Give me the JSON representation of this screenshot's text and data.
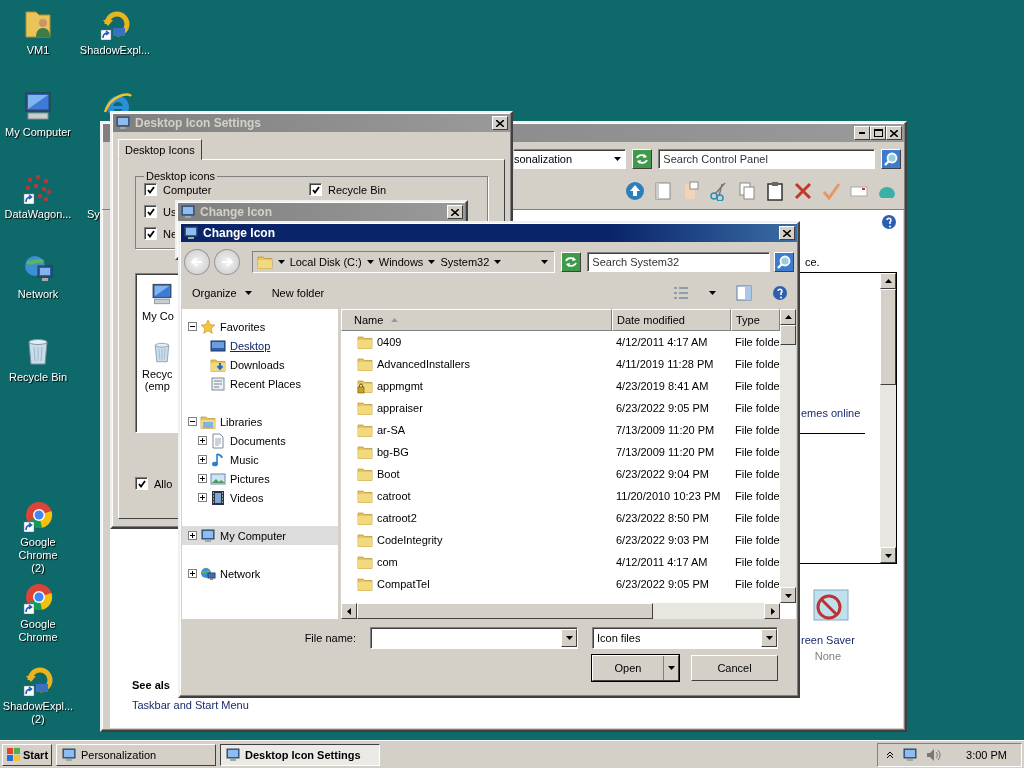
{
  "desktop_icons": [
    {
      "label": "VM1",
      "kind": "user-folder"
    },
    {
      "label": "ShadowExpl...",
      "kind": "shadow"
    },
    {
      "label": "My Computer",
      "kind": "computer"
    },
    {
      "kind": "browser-e"
    },
    {
      "label": "DataWagon...",
      "kind": "dots"
    },
    {
      "label": "Sy",
      "kind": "label-only"
    },
    {
      "label": "Network",
      "kind": "network"
    },
    {
      "label": "Recycle Bin",
      "kind": "recycle"
    },
    {
      "label": "Google Chrome\n(2)",
      "kind": "chrome"
    },
    {
      "label": "Google Chrome",
      "kind": "chrome"
    },
    {
      "label": "ShadowExpl...\n(2)",
      "kind": "shadow"
    }
  ],
  "personalization_window": {
    "active": false,
    "address": "sonalization",
    "search": {
      "placeholder": "Search Control Panel"
    },
    "text_fragment": "ce.",
    "theme_link": "emes online",
    "screen_saver": {
      "label": "reen Saver",
      "value": "None"
    },
    "see_also": {
      "heading": "See als",
      "links": [
        "Taskbar and Start Menu"
      ]
    }
  },
  "desktop_icon_settings": {
    "title": "Desktop Icon Settings",
    "active": false,
    "tabs": [
      {
        "label": "Desktop Icons",
        "selected": true
      }
    ],
    "group_label": "Desktop icons",
    "checkboxes": [
      {
        "label": "Computer",
        "checked": true
      },
      {
        "label": "Recycle Bin",
        "checked": true
      },
      {
        "label": "Us",
        "checked": true
      },
      {
        "label": "Ne",
        "checked": true
      }
    ],
    "icon_list": [
      {
        "label": "My Co",
        "kind": "computer"
      },
      {
        "label": "Recyc\n(emp",
        "kind": "recycle"
      }
    ],
    "allow": {
      "label": "Allo",
      "checked": true
    }
  },
  "background_dialog": {
    "title": "Change Icon",
    "active": false
  },
  "change_icon": {
    "title": "Change Icon",
    "active": true,
    "breadcrumbs": [
      "Local Disk (C:)",
      "Windows",
      "System32"
    ],
    "search": {
      "placeholder": "Search System32"
    },
    "commands": [
      {
        "label": "Organize",
        "menu": true
      },
      {
        "label": "New folder",
        "menu": false
      }
    ],
    "nav": [
      {
        "label": "Favorites",
        "kind": "star",
        "expanded": true,
        "selected": false,
        "hovered": false,
        "children": [
          {
            "label": "Desktop",
            "kind": "desktop",
            "selected": false,
            "hovered": true
          },
          {
            "label": "Downloads",
            "kind": "downloads",
            "selected": false,
            "hovered": false
          },
          {
            "label": "Recent Places",
            "kind": "recent",
            "selected": false,
            "hovered": false
          }
        ]
      },
      {
        "label": "Libraries",
        "kind": "library",
        "expanded": true,
        "selected": false,
        "hovered": false,
        "children": [
          {
            "label": "Documents",
            "kind": "documents",
            "expanded": false,
            "selected": false,
            "hovered": false
          },
          {
            "label": "Music",
            "kind": "music",
            "expanded": false,
            "selected": false,
            "hovered": false
          },
          {
            "label": "Pictures",
            "kind": "pictures",
            "expanded": false,
            "selected": false,
            "hovered": false
          },
          {
            "label": "Videos",
            "kind": "videos",
            "expanded": false,
            "selected": false,
            "hovered": false
          }
        ]
      },
      {
        "label": "My Computer",
        "kind": "computer",
        "expanded": false,
        "selected": true,
        "hovered": false
      },
      {
        "label": "Network",
        "kind": "network",
        "expanded": false,
        "selected": false,
        "hovered": false
      }
    ],
    "columns": [
      {
        "label": "Name",
        "sorted": true
      },
      {
        "label": "Date modified",
        "sorted": false
      },
      {
        "label": "Type",
        "sorted": false
      }
    ],
    "rows": [
      {
        "name": "0409",
        "date": "4/12/2011 4:17 AM",
        "type": "File folde",
        "kind": "folder"
      },
      {
        "name": "AdvancedInstallers",
        "date": "4/11/2019 11:28 PM",
        "type": "File folde",
        "kind": "folder"
      },
      {
        "name": "appmgmt",
        "date": "4/23/2019 8:41 AM",
        "type": "File folde",
        "kind": "locked-folder"
      },
      {
        "name": "appraiser",
        "date": "6/23/2022 9:05 PM",
        "type": "File folde",
        "kind": "folder"
      },
      {
        "name": "ar-SA",
        "date": "7/13/2009 11:20 PM",
        "type": "File folde",
        "kind": "folder"
      },
      {
        "name": "bg-BG",
        "date": "7/13/2009 11:20 PM",
        "type": "File folde",
        "kind": "folder"
      },
      {
        "name": "Boot",
        "date": "6/23/2022 9:04 PM",
        "type": "File folde",
        "kind": "folder"
      },
      {
        "name": "catroot",
        "date": "11/20/2010 10:23 PM",
        "type": "File folde",
        "kind": "folder"
      },
      {
        "name": "catroot2",
        "date": "6/23/2022 8:50 PM",
        "type": "File folde",
        "kind": "folder"
      },
      {
        "name": "CodeIntegrity",
        "date": "6/23/2022 9:03 PM",
        "type": "File folde",
        "kind": "folder"
      },
      {
        "name": "com",
        "date": "4/12/2011 4:17 AM",
        "type": "File folde",
        "kind": "folder"
      },
      {
        "name": "CompatTel",
        "date": "6/23/2022 9:05 PM",
        "type": "File folde",
        "kind": "folder"
      }
    ],
    "file_name": {
      "label": "File name:"
    },
    "file_type": "Icon files",
    "buttons": [
      {
        "label": "Open",
        "kind": "split"
      },
      {
        "label": "Cancel",
        "kind": "plain"
      }
    ]
  },
  "taskbar": {
    "start": "Start",
    "tasks": [
      {
        "label": "Personalization",
        "selected": false
      },
      {
        "label": "Desktop Icon Settings",
        "selected": true
      }
    ],
    "clock": "3:00 PM"
  }
}
